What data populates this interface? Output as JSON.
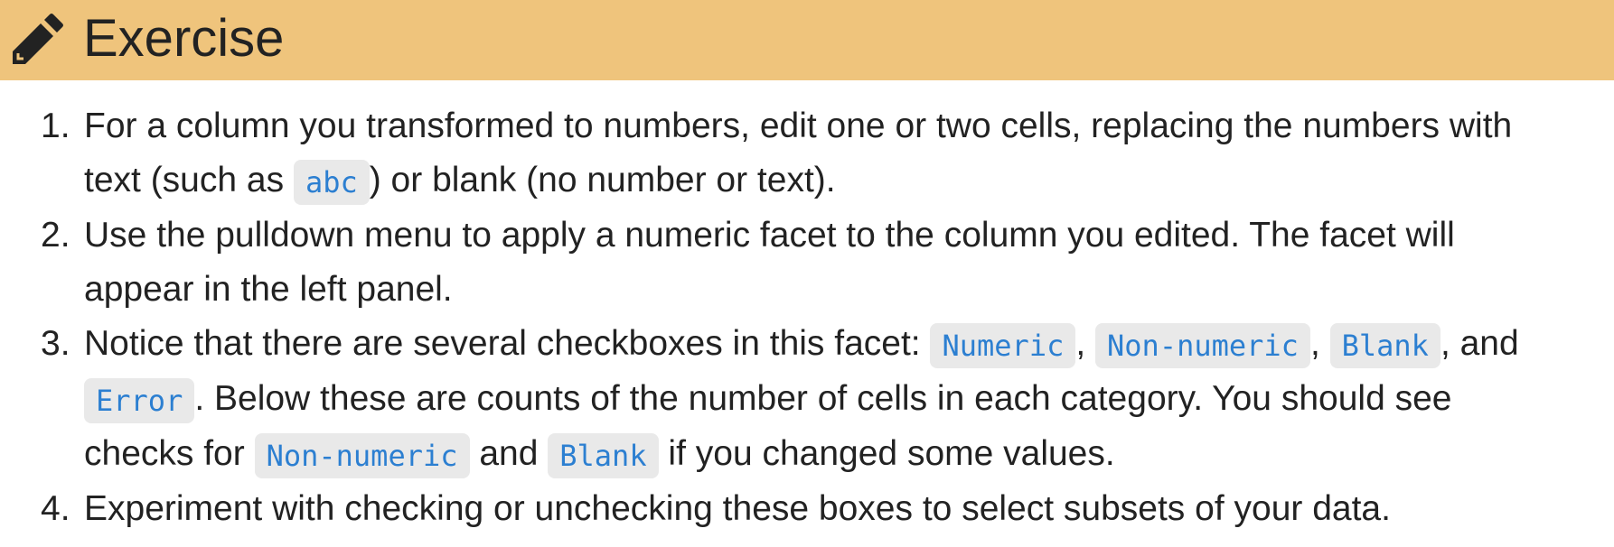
{
  "header": {
    "title": "Exercise",
    "icon": "pencil-icon",
    "background": "#efc47c"
  },
  "items": [
    {
      "number": "1.",
      "t1": "For a column you transformed to numbers, edit one or two cells, replacing the numbers with text (such as ",
      "c1": "abc",
      "t2": ") or blank (no number or text)."
    },
    {
      "number": "2.",
      "t1": "Use the pulldown menu to apply a numeric facet to the column you edited. The facet will appear in the left panel."
    },
    {
      "number": "3.",
      "t1": "Notice that there are several checkboxes in this facet: ",
      "c1": "Numeric",
      "t2": ", ",
      "c2": "Non-numeric",
      "t3": ", ",
      "c3": "Blank",
      "t4": ", and ",
      "c4": "Error",
      "t5": ". Below these are counts of the number of cells in each category. You should see checks for ",
      "c5": "Non-numeric",
      "t6": " and ",
      "c6": "Blank",
      "t7": " if you changed some values."
    },
    {
      "number": "4.",
      "t1": "Experiment with checking or unchecking these boxes to select subsets of your data."
    }
  ],
  "colors": {
    "code_text": "#2c7fd1",
    "code_background": "#e9e9e9",
    "body_text": "#222222"
  }
}
